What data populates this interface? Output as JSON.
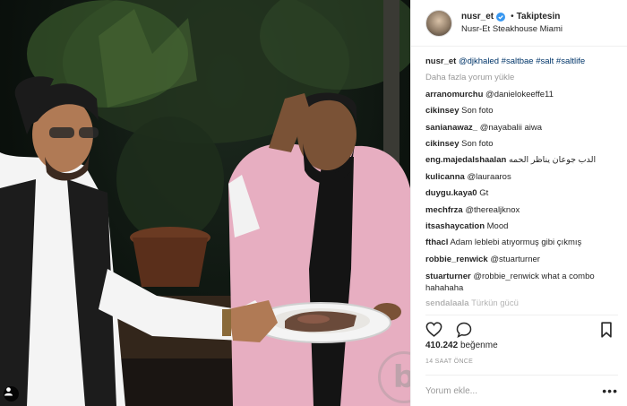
{
  "colors": {
    "accent_link": "#003569",
    "muted_text": "#999999",
    "verified_blue": "#3897f0",
    "jacket_pink": "#e7aec1"
  },
  "header": {
    "username": "nusr_et",
    "separator": "•",
    "follow_label": "Takiptesin",
    "location": "Nusr-Et Steakhouse Miami"
  },
  "caption": {
    "user": "nusr_et",
    "mention": "@djkhaled",
    "hashtags": "#saltbae #salt #saltlife"
  },
  "load_more": "Daha fazla yorum yükle",
  "comments": [
    {
      "user": "arranomurchu",
      "text": "@danielokeeffe11",
      "mention": true
    },
    {
      "user": "cikinsey",
      "text": "Son foto",
      "mention": false
    },
    {
      "user": "sanianawaz_",
      "text": "@nayabalii aiwa",
      "mention": false
    },
    {
      "user": "cikinsey",
      "text": "Son foto",
      "mention": false
    },
    {
      "user": "eng.majedalshaalan",
      "text": "الدب جوعان يناظر الحمه",
      "mention": false
    },
    {
      "user": "kulicanna",
      "text": "@lauraaros",
      "mention": true
    },
    {
      "user": "duygu.kaya0",
      "text": "Gt",
      "mention": false
    },
    {
      "user": "mechfrza",
      "text": "@therealjknox",
      "mention": true
    },
    {
      "user": "itsashaycation",
      "text": "Mood",
      "mention": false
    },
    {
      "user": "fthacl",
      "text": "Adam leblebi atıyormuş gibi çıkmış",
      "mention": false
    },
    {
      "user": "robbie_renwick",
      "text": "@stuarturner",
      "mention": true
    },
    {
      "user": "stuarturner",
      "text_mention": "@robbie_renwick",
      "text": "what a combo hahahaha"
    },
    {
      "user": "sendalaala",
      "text": "Türkün gücü"
    }
  ],
  "actions": {
    "like_icon": "heart-icon",
    "comment_icon": "comment-bubble-icon",
    "save_icon": "bookmark-icon"
  },
  "likes": {
    "count": "410.242",
    "label": "beğenme"
  },
  "timestamp": "14 SAAT ÖNCE",
  "add_comment": {
    "placeholder": "Yorum ekle...",
    "more": "•••"
  },
  "watermark": "b"
}
